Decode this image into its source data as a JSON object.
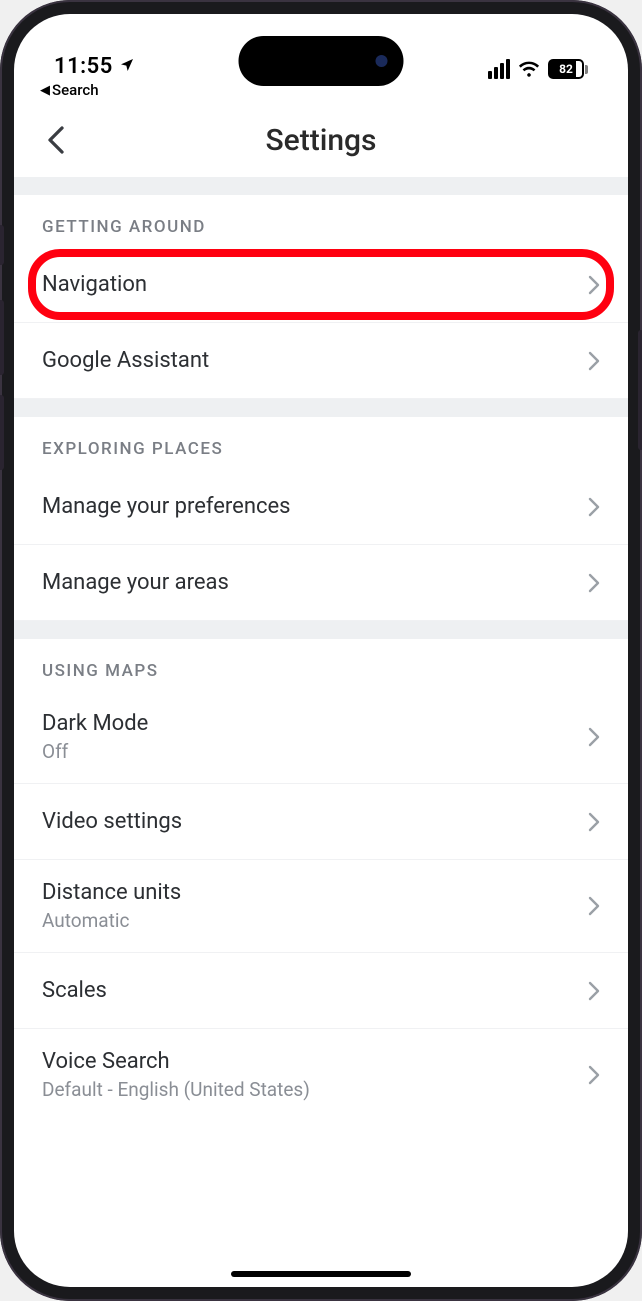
{
  "status": {
    "time": "11:55",
    "battery_pct": "82"
  },
  "back_strip": {
    "label": "Search"
  },
  "header": {
    "title": "Settings"
  },
  "sections": [
    {
      "title": "GETTING AROUND",
      "rows": [
        {
          "label": "Navigation",
          "highlight": true
        },
        {
          "label": "Google Assistant"
        }
      ]
    },
    {
      "title": "EXPLORING PLACES",
      "rows": [
        {
          "label": "Manage your preferences"
        },
        {
          "label": "Manage your areas"
        }
      ]
    },
    {
      "title": "USING MAPS",
      "rows": [
        {
          "label": "Dark Mode",
          "sub": "Off"
        },
        {
          "label": "Video settings"
        },
        {
          "label": "Distance units",
          "sub": "Automatic"
        },
        {
          "label": "Scales"
        },
        {
          "label": "Voice Search",
          "sub": "Default - English (United States)"
        }
      ]
    }
  ]
}
